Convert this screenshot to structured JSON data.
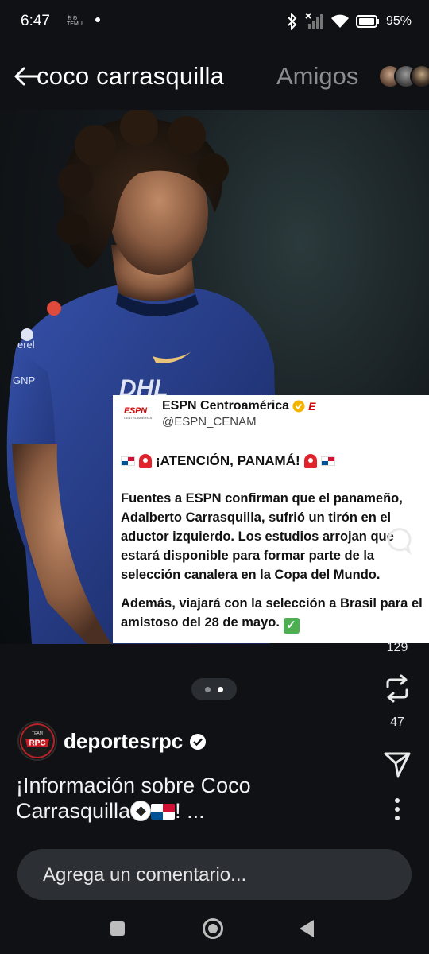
{
  "status_bar": {
    "time": "6:47",
    "mini_text": "ぁ゙゙゙゙",
    "battery": "95%",
    "icons": [
      "bluetooth-icon",
      "signal-off-icon",
      "wifi-icon",
      "battery-icon"
    ]
  },
  "header": {
    "title": "coco carrasquilla",
    "friends_label": "Amigos",
    "back_icon": "back-arrow-icon"
  },
  "tweet": {
    "logo": "ESPN",
    "logo_sub": "CENTROAMÉRICA",
    "name": "ESPN Centroamérica",
    "handle": "@ESPN_CENAM",
    "headline": "¡ATENCIÓN, PANAMÁ!",
    "body": "Fuentes a ESPN confirman que el panameño, Adalberto Carrasquilla, sufrió un tirón en el aductor izquierdo. Los estudios arrojan que estará disponible para formar parte de la selección canalera en la Copa del Mundo.",
    "body2": "Además, viajará con la selección a Brasil para el amistoso del 28 de mayo."
  },
  "rail": {
    "repost_count": "129",
    "share_count": "47"
  },
  "author": {
    "avatar_text": "RPC",
    "avatar_top": "TEAM",
    "name": "deportesrpc"
  },
  "caption": {
    "text_a": "¡Información sobre Coco Carrasquilla",
    "text_b": "! ..."
  },
  "comment": {
    "placeholder": "Agrega un comentario..."
  },
  "colors": {
    "background": "#0f1114",
    "jersey": "#2a3f8f",
    "espn_red": "#d20a0a",
    "verified_gold": "#f4b400"
  }
}
